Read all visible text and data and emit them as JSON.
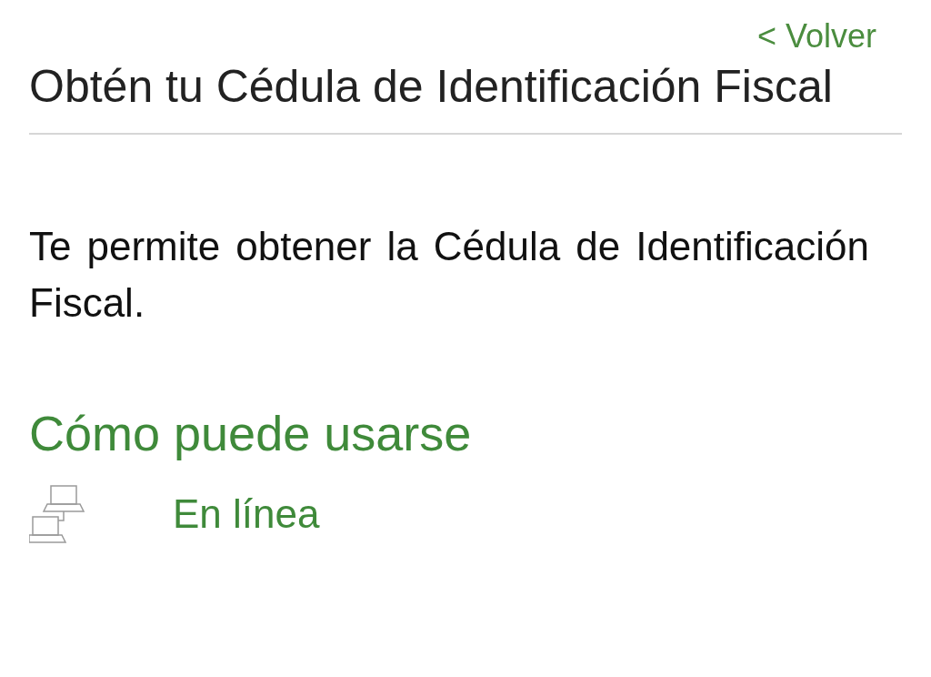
{
  "back_link": "< Volver",
  "title": "Obtén tu Cédula de Identificación Fiscal",
  "description": "Te permite obtener la Cédula de Identificación Fiscal.",
  "section_heading": "Cómo puede usarse",
  "usage_options": [
    {
      "kind": "online",
      "label": "En línea"
    }
  ]
}
